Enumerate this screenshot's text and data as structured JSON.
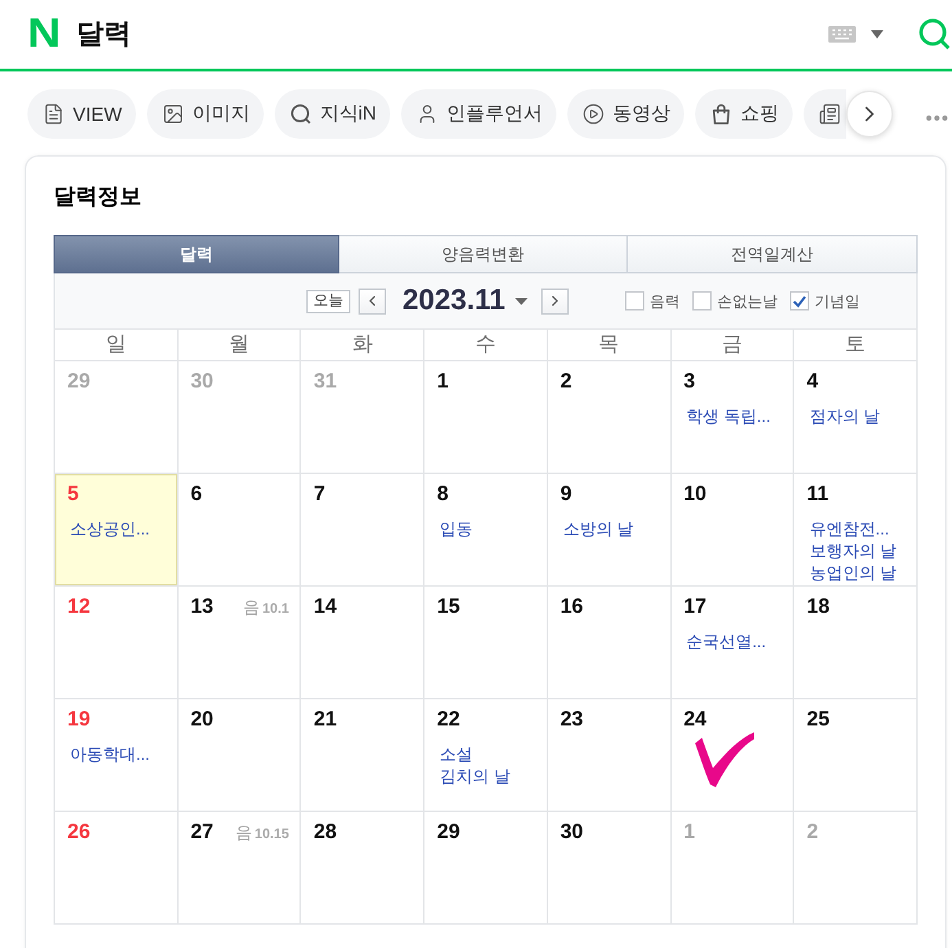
{
  "header": {
    "logo": "N",
    "title": "달력"
  },
  "categories": [
    {
      "label": "VIEW"
    },
    {
      "label": "이미지"
    },
    {
      "label": "지식iN"
    },
    {
      "label": "인플루언서"
    },
    {
      "label": "동영상"
    },
    {
      "label": "쇼핑"
    }
  ],
  "card": {
    "title": "달력정보"
  },
  "calendar": {
    "tabs": [
      {
        "label": "달력",
        "selected": true
      },
      {
        "label": "양음력변환",
        "selected": false
      },
      {
        "label": "전역일계산",
        "selected": false
      }
    ],
    "today_button": "오늘",
    "month": "2023.11",
    "filters": [
      {
        "label": "음력",
        "checked": false
      },
      {
        "label": "손없는날",
        "checked": false
      },
      {
        "label": "기념일",
        "checked": true
      }
    ],
    "weekdays": [
      "일",
      "월",
      "화",
      "수",
      "목",
      "금",
      "토"
    ],
    "weeks": [
      [
        {
          "date": "29",
          "in_month": false,
          "today": false,
          "marked": false
        },
        {
          "date": "30",
          "in_month": false,
          "today": false,
          "marked": false
        },
        {
          "date": "31",
          "in_month": false,
          "today": false,
          "marked": false
        },
        {
          "date": "1",
          "in_month": true,
          "today": false,
          "marked": false
        },
        {
          "date": "2",
          "in_month": true,
          "today": false,
          "marked": false
        },
        {
          "date": "3",
          "in_month": true,
          "today": false,
          "marked": false,
          "events": [
            "학생 독립..."
          ]
        },
        {
          "date": "4",
          "in_month": true,
          "today": false,
          "marked": false,
          "events": [
            "점자의 날"
          ]
        }
      ],
      [
        {
          "date": "5",
          "in_month": true,
          "today": true,
          "marked": false,
          "events": [
            "소상공인..."
          ]
        },
        {
          "date": "6",
          "in_month": true,
          "today": false,
          "marked": false
        },
        {
          "date": "7",
          "in_month": true,
          "today": false,
          "marked": false
        },
        {
          "date": "8",
          "in_month": true,
          "today": false,
          "marked": false,
          "events": [
            "입동"
          ]
        },
        {
          "date": "9",
          "in_month": true,
          "today": false,
          "marked": false,
          "events": [
            "소방의 날"
          ]
        },
        {
          "date": "10",
          "in_month": true,
          "today": false,
          "marked": false
        },
        {
          "date": "11",
          "in_month": true,
          "today": false,
          "marked": false,
          "events": [
            "유엔참전...",
            "보행자의 날",
            "농업인의 날"
          ]
        }
      ],
      [
        {
          "date": "12",
          "in_month": true,
          "today": false,
          "marked": false
        },
        {
          "date": "13",
          "in_month": true,
          "today": false,
          "marked": false,
          "lunar": {
            "prefix": "음",
            "date": "10.1"
          }
        },
        {
          "date": "14",
          "in_month": true,
          "today": false,
          "marked": false
        },
        {
          "date": "15",
          "in_month": true,
          "today": false,
          "marked": false
        },
        {
          "date": "16",
          "in_month": true,
          "today": false,
          "marked": false
        },
        {
          "date": "17",
          "in_month": true,
          "today": false,
          "marked": false,
          "events": [
            "순국선열..."
          ]
        },
        {
          "date": "18",
          "in_month": true,
          "today": false,
          "marked": false
        }
      ],
      [
        {
          "date": "19",
          "in_month": true,
          "today": false,
          "marked": false,
          "events": [
            "아동학대..."
          ]
        },
        {
          "date": "20",
          "in_month": true,
          "today": false,
          "marked": false
        },
        {
          "date": "21",
          "in_month": true,
          "today": false,
          "marked": false
        },
        {
          "date": "22",
          "in_month": true,
          "today": false,
          "marked": false,
          "events": [
            "소설",
            "김치의 날"
          ]
        },
        {
          "date": "23",
          "in_month": true,
          "today": false,
          "marked": false
        },
        {
          "date": "24",
          "in_month": true,
          "today": false,
          "marked": true
        },
        {
          "date": "25",
          "in_month": true,
          "today": false,
          "marked": false
        }
      ],
      [
        {
          "date": "26",
          "in_month": true,
          "today": false,
          "marked": false
        },
        {
          "date": "27",
          "in_month": true,
          "today": false,
          "marked": false,
          "lunar": {
            "prefix": "음",
            "date": "10.15"
          }
        },
        {
          "date": "28",
          "in_month": true,
          "today": false,
          "marked": false
        },
        {
          "date": "29",
          "in_month": true,
          "today": false,
          "marked": false
        },
        {
          "date": "30",
          "in_month": true,
          "today": false,
          "marked": false
        },
        {
          "date": "1",
          "in_month": false,
          "today": false,
          "marked": false
        },
        {
          "date": "2",
          "in_month": false,
          "today": false,
          "marked": false
        }
      ]
    ]
  }
}
